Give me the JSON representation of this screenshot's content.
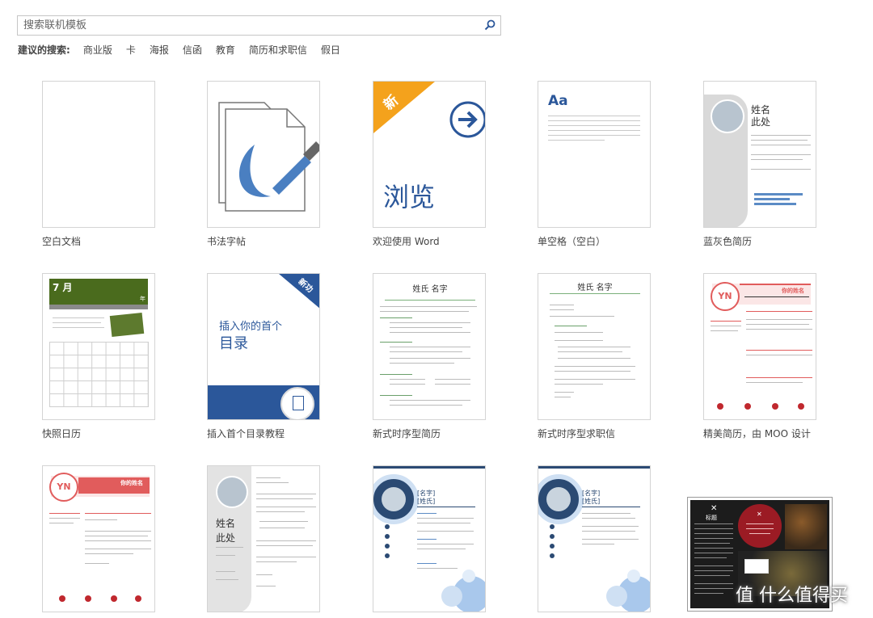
{
  "search": {
    "placeholder": "搜索联机模板"
  },
  "suggestions": {
    "label": "建议的搜索:",
    "items": [
      "商业版",
      "卡",
      "海报",
      "信函",
      "教育",
      "简历和求职信",
      "假日"
    ]
  },
  "templates": [
    {
      "caption": "空白文档"
    },
    {
      "caption": "书法字帖"
    },
    {
      "caption": "欢迎使用 Word",
      "badge": "新",
      "big_text": "浏览"
    },
    {
      "caption": "单空格（空白）",
      "aa": "Aa"
    },
    {
      "caption": "蓝灰色简历",
      "name_line1": "姓名",
      "name_line2": "此处"
    },
    {
      "caption": "快照日历",
      "month": "7 月",
      "year": "年"
    },
    {
      "caption": "插入首个目录教程",
      "badge": "新功",
      "line1": "插入你的首个",
      "line2": "目录"
    },
    {
      "caption": "新式时序型简历",
      "header": "姓氏 名字"
    },
    {
      "caption": "新式时序型求职信",
      "header": "姓氏 名字"
    },
    {
      "caption": "精美简历，由 MOO 设计",
      "monogram": "YN",
      "title": "你的姓名"
    },
    {
      "monogram": "YN",
      "title": "你的姓名"
    },
    {
      "name_line1": "姓名",
      "name_line2": "此处"
    },
    {
      "name": "[名字]",
      "surname": "[姓氏]"
    },
    {
      "name": "[名字]",
      "surname": "[姓氏]"
    },
    {
      "heading": "标题"
    }
  ],
  "watermark": {
    "text": "值 什么值得买"
  },
  "colors": {
    "accent_blue": "#2b579a",
    "badge_orange": "#f4a21c",
    "red": "#e15c5c",
    "green": "#4a6b1d"
  }
}
